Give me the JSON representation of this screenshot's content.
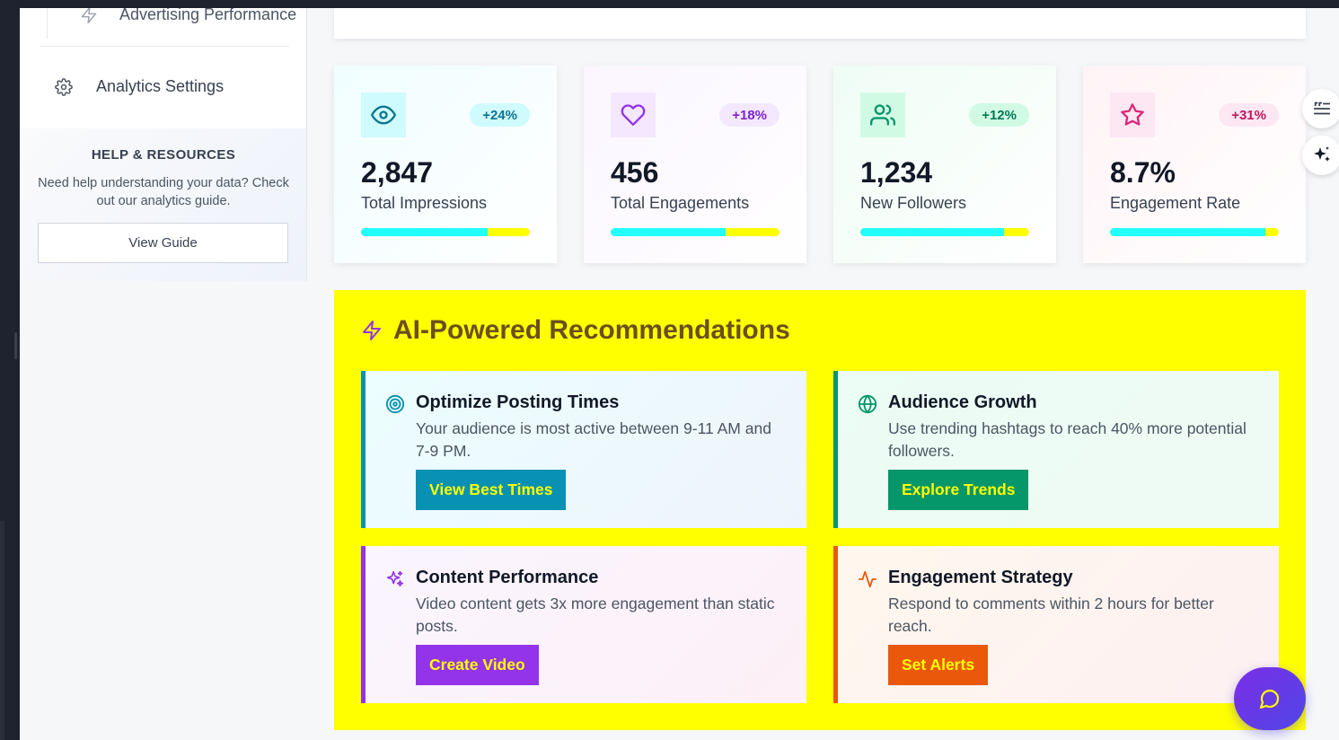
{
  "sidebar": {
    "sub_item": {
      "label": "Advertising Performance",
      "icon": "zap-icon"
    },
    "nav_item": {
      "label": "Analytics Settings",
      "icon": "gear-icon"
    },
    "help": {
      "title": "HELP & RESOURCES",
      "description": "Need help understanding your data? Check out our analytics guide.",
      "button_label": "View Guide"
    }
  },
  "stats": [
    {
      "value": "2,847",
      "label": "Total Impressions",
      "change": "+24%",
      "icon": "eye-icon",
      "progress": 0.75
    },
    {
      "value": "456",
      "label": "Total Engagements",
      "change": "+18%",
      "icon": "heart-icon",
      "progress": 0.68
    },
    {
      "value": "1,234",
      "label": "New Followers",
      "change": "+12%",
      "icon": "users-icon",
      "progress": 0.85
    },
    {
      "value": "8.7%",
      "label": "Engagement Rate",
      "change": "+31%",
      "icon": "star-icon",
      "progress": 0.92
    }
  ],
  "ai": {
    "title": "AI-Powered Recommendations",
    "icon": "zap-icon",
    "recommendations": [
      {
        "title": "Optimize Posting Times",
        "description": "Your audience is most active between 9-11 AM and 7-9 PM.",
        "button": "View Best Times",
        "icon": "target-icon",
        "accent": "#0891b2"
      },
      {
        "title": "Audience Growth",
        "description": "Use trending hashtags to reach 40% more potential followers.",
        "button": "Explore Trends",
        "icon": "globe-icon",
        "accent": "#059669"
      },
      {
        "title": "Content Performance",
        "description": "Video content gets 3x more engagement than static posts.",
        "button": "Create Video",
        "icon": "sparkles-icon",
        "accent": "#9333ea"
      },
      {
        "title": "Engagement Strategy",
        "description": "Respond to comments within 2 hours for better reach.",
        "button": "Set Alerts",
        "icon": "activity-icon",
        "accent": "#ea580c"
      }
    ]
  },
  "colors": {
    "highlight": "#ffff00",
    "progress_fill": "#22ffff",
    "chat_gradient": [
      "#7c2ee8",
      "#4f46e5"
    ]
  }
}
